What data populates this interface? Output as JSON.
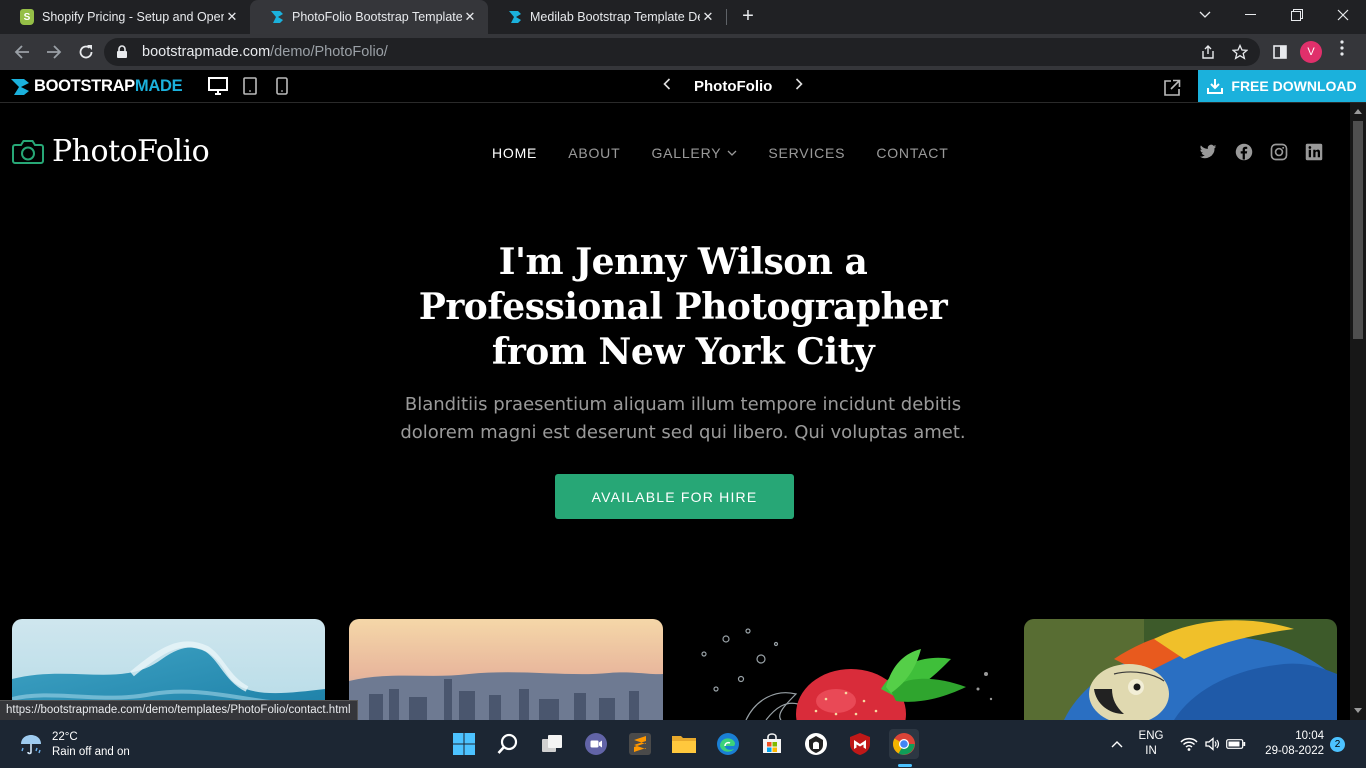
{
  "browser": {
    "tabs": [
      {
        "label": "Shopify Pricing - Setup and Open",
        "close": "✕"
      },
      {
        "label": "PhotoFolio Bootstrap Template D",
        "close": "✕"
      },
      {
        "label": "Medilab Bootstrap Template Dem",
        "close": "✕"
      }
    ],
    "new_tab": "+",
    "url_host": "bootstrapmade.com",
    "url_path": "/demo/PhotoFolio/",
    "profile_initial": "V",
    "status_url": "https://bootstrapmade.com/demo/templates/PhotoFolio/contact.html"
  },
  "bm_bar": {
    "logo_part1": "BOOTSTRAP",
    "logo_part2": "MADE",
    "template_name": "PhotoFolio",
    "download_label": "FREE DOWNLOAD"
  },
  "site": {
    "logo_text": "PhotoFolio",
    "nav": [
      "HOME",
      "ABOUT",
      "GALLERY",
      "SERVICES",
      "CONTACT"
    ],
    "hero": {
      "pre": "I'm ",
      "name": "Jenny Wilson",
      "post": " a",
      "line2": "Professional Photographer",
      "line3": "from New York City",
      "desc": "Blanditiis praesentium aliquam illum tempore incidunt debitis dolorem magni est deserunt sed qui libero. Qui voluptas amet.",
      "cta": "AVAILABLE FOR HIRE"
    },
    "accent_color": "#27a776"
  },
  "taskbar": {
    "temp": "22°C",
    "weather": "Rain off and on",
    "lang": "ENG",
    "region": "IN",
    "time": "10:04",
    "date": "29-08-2022",
    "notifications": "2"
  },
  "colors": {
    "bm_blue": "#1bb1dc",
    "taskbar": "#1c2633"
  }
}
